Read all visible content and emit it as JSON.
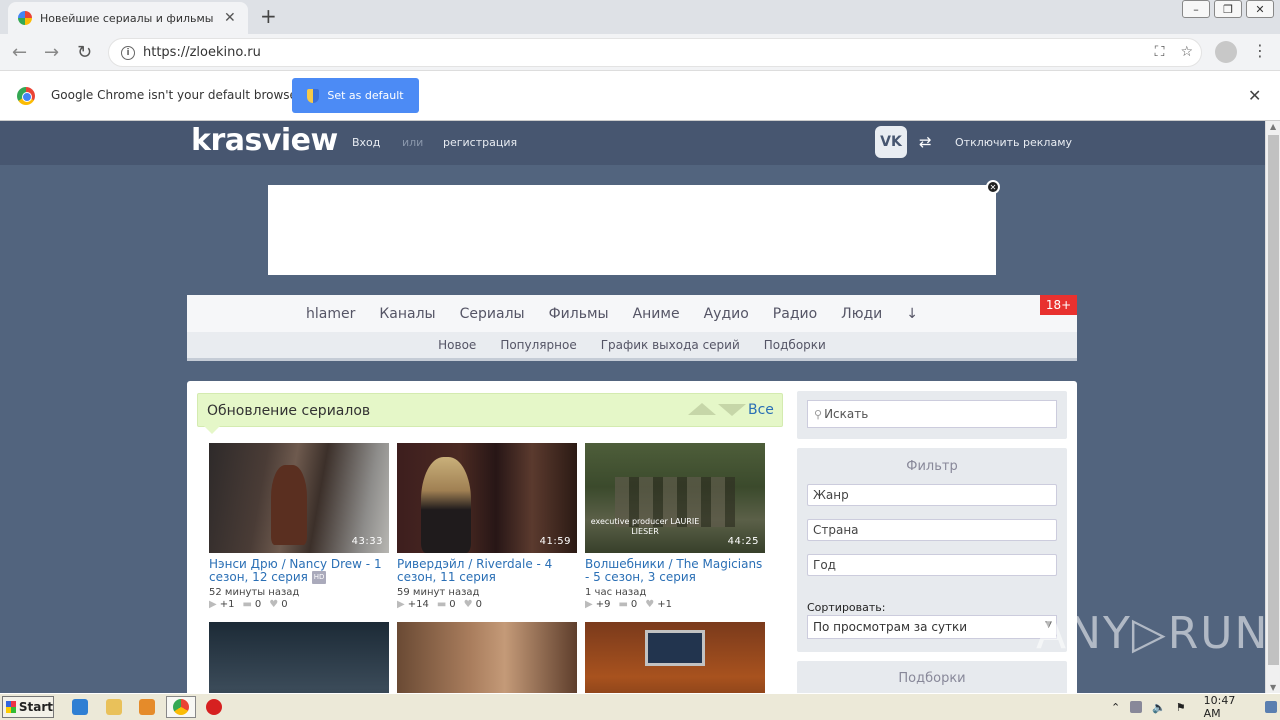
{
  "browser": {
    "tab_title": "Новейшие сериалы и фильмы смот",
    "url": "https://zloekino.ru",
    "infobar_message": "Google Chrome isn't your default browser",
    "infobar_button": "Set as default"
  },
  "site": {
    "logo": "krasview",
    "header": {
      "login": "Вход",
      "or": "или",
      "register": "регистрация",
      "vk": "VK",
      "disable_ads": "Отключить рекламу"
    },
    "main_nav": [
      "hlamer",
      "Каналы",
      "Сериалы",
      "Фильмы",
      "Аниме",
      "Аудио",
      "Радио",
      "Люди",
      "↓"
    ],
    "sub_nav": [
      "Новое",
      "Популярное",
      "График выхода серий",
      "Подборки"
    ],
    "age_badge": "18+",
    "section": {
      "title": "Обновление сериалов",
      "all_link": "Все"
    },
    "cards": [
      {
        "title": "Нэнси Дрю / Nancy Drew - 1 сезон, 12 серия",
        "hd": "HD",
        "duration": "43:33",
        "time": "52 минуты назад",
        "plus": "+1",
        "comments": "0",
        "likes": "0"
      },
      {
        "title": "Ривердэйл / Riverdale - 4 сезон, 11 серия",
        "hd": "",
        "duration": "41:59",
        "time": "59 минут назад",
        "plus": "+14",
        "comments": "0",
        "likes": "0"
      },
      {
        "title": "Волшебники / The Magicians - 5 сезон, 3 серия",
        "hd": "",
        "duration": "44:25",
        "caption": "executive producer LAURIE LIESER",
        "time": "1 час назад",
        "plus": "+9",
        "comments": "0",
        "likes": "+1"
      }
    ],
    "sidebar": {
      "search_placeholder": "Искать",
      "filter_title": "Фильтр",
      "genre": "Жанр",
      "country": "Страна",
      "year": "Год",
      "sort_label": "Сортировать:",
      "sort_value": "По просмотрам за сутки",
      "collections_title": "Подборки"
    }
  },
  "watermark": "ANY▷RUN",
  "taskbar": {
    "start": "Start",
    "clock": "10:47 AM"
  }
}
